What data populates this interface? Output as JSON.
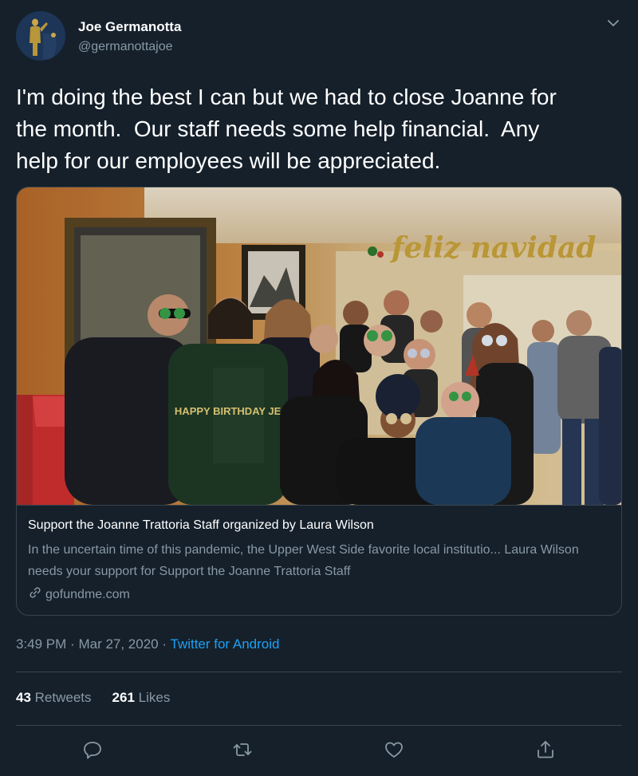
{
  "user": {
    "name": "Joe Germanotta",
    "handle": "@germanottajoe"
  },
  "tweet": {
    "text": "I'm doing the best I can but we had to close Joanne for\nthe month.  Our staff needs some help financial.  Any\nhelp for our employees will be appreciated."
  },
  "card": {
    "photo_banner": "feliz navidad",
    "sweater_text": "HAPPY BIRTHDAY JESUS",
    "title": "Support the Joanne Trattoria Staff organized by Laura Wilson",
    "description": "In the  uncertain time of this pandemic, the Upper West Side favorite local institutio... Laura Wilson needs your support for Support the Joanne Trattoria Staff",
    "domain": "gofundme.com"
  },
  "meta": {
    "time": "3:49 PM",
    "date": "Mar 27, 2020",
    "separator": "·",
    "source": "Twitter for Android"
  },
  "stats": {
    "retweets_count": "43",
    "retweets_label": "Retweets",
    "likes_count": "261",
    "likes_label": "Likes"
  },
  "icons": {
    "reply": "reply-icon",
    "retweet": "retweet-icon",
    "like": "like-icon",
    "share": "share-icon",
    "more": "chevron-down-icon",
    "link": "link-icon"
  },
  "colors": {
    "background": "#15202b",
    "secondary_text": "#8899a6",
    "accent": "#1da1f2",
    "border": "#38444d"
  }
}
